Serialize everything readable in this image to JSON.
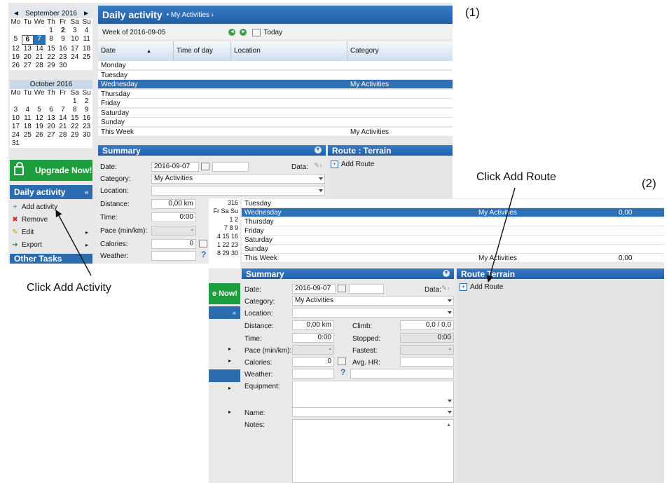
{
  "figure": {
    "label1": "(1)",
    "label2": "(2)",
    "annot_activity": "Click Add Activity",
    "annot_route": "Click Add Route"
  },
  "calendar": {
    "sep": {
      "title": "September 2016",
      "prev": "◄",
      "next": "►",
      "dow": [
        "Mo",
        "Tu",
        "We",
        "Th",
        "Fr",
        "Sa",
        "Su"
      ],
      "days": [
        "",
        "",
        "",
        "1",
        "2",
        "3",
        "4",
        "5",
        "6",
        "7",
        "8",
        "9",
        "10",
        "11",
        "12",
        "13",
        "14",
        "15",
        "16",
        "17",
        "18",
        "19",
        "20",
        "21",
        "22",
        "23",
        "24",
        "25",
        "26",
        "27",
        "28",
        "29",
        "30",
        "",
        "",
        ""
      ]
    },
    "oct": {
      "title": "October 2016",
      "dow": [
        "Mo",
        "Tu",
        "We",
        "Th",
        "Fr",
        "Sa",
        "Su"
      ],
      "days": [
        "",
        "",
        "",
        "",
        "",
        "1",
        "2",
        "3",
        "4",
        "5",
        "6",
        "7",
        "8",
        "9",
        "10",
        "11",
        "12",
        "13",
        "14",
        "15",
        "16",
        "17",
        "18",
        "19",
        "20",
        "21",
        "22",
        "23",
        "24",
        "25",
        "26",
        "27",
        "28",
        "29",
        "30",
        "31",
        "",
        "",
        "",
        "",
        "",
        ""
      ]
    }
  },
  "left": {
    "upgrade": "Upgrade Now!",
    "upgrade_short": "e Now!",
    "daily": "Daily activity",
    "items": [
      {
        "label": "Add activity",
        "icon": "+"
      },
      {
        "label": "Remove",
        "icon": "✖"
      },
      {
        "label": "Edit",
        "icon": "✎"
      },
      {
        "label": "Export",
        "icon": "➔"
      }
    ],
    "other": "Other Tasks"
  },
  "main": {
    "title": "Daily activity",
    "crumb": "• My Activities ›",
    "week": "Week of 2016-09-05",
    "today": "Today",
    "cols": [
      "Date",
      "Time of day",
      "Location",
      "Category"
    ],
    "rows": [
      {
        "day": "Monday",
        "cat": ""
      },
      {
        "day": "Tuesday",
        "cat": ""
      },
      {
        "day": "Wednesday",
        "cat": "My Activities"
      },
      {
        "day": "Thursday",
        "cat": ""
      },
      {
        "day": "Friday",
        "cat": ""
      },
      {
        "day": "Saturday",
        "cat": ""
      },
      {
        "day": "Sunday",
        "cat": ""
      },
      {
        "day": "This Week",
        "cat": "My Activities"
      }
    ]
  },
  "rows2": [
    {
      "day": "Tuesday",
      "cat": "",
      "val": ""
    },
    {
      "day": "Wednesday",
      "cat": "My Activities",
      "val": "0,00"
    },
    {
      "day": "Thursday",
      "cat": "",
      "val": ""
    },
    {
      "day": "Friday",
      "cat": "",
      "val": ""
    },
    {
      "day": "Saturday",
      "cat": "",
      "val": ""
    },
    {
      "day": "Sunday",
      "cat": "",
      "val": ""
    },
    {
      "day": "This Week",
      "cat": "My Activities",
      "val": "0,00"
    }
  ],
  "summary": {
    "title": "Summary",
    "date_label": "Date:",
    "date": "2016-09-07",
    "data_label": "Data:",
    "category_label": "Category:",
    "category": "My Activities",
    "location_label": "Location:",
    "distance_label": "Distance:",
    "distance": "0,00 km",
    "time_label": "Time:",
    "time": "0:00",
    "pace_label": "Pace (min/km):",
    "pace": "-",
    "calories_label": "Calories:",
    "calories": "0",
    "weather_label": "Weather:",
    "climb_label": "Climb:",
    "climb": "0,0 / 0,0",
    "stopped_label": "Stopped:",
    "stopped": "0:00",
    "fastest_label": "Fastest:",
    "fastest": "-",
    "avghr_label": "Avg. HR:",
    "equipment_label": "Equipment:",
    "name_label": "Name:",
    "notes_label": "Notes:",
    "help": "?"
  },
  "route": {
    "title": "Route : Terrain",
    "title_partial": "Route Terrain",
    "add": "Add Route"
  },
  "behind": {
    "cal_frag": [
      "316",
      "Fr Sa Su",
      "1 2",
      "7 8 9",
      "4 15 16",
      "1 22 23",
      "8 29 30"
    ]
  },
  "colors": {
    "blue": "#2b6cb0",
    "green": "#1e9d3c",
    "select": "#2f6fb3"
  }
}
